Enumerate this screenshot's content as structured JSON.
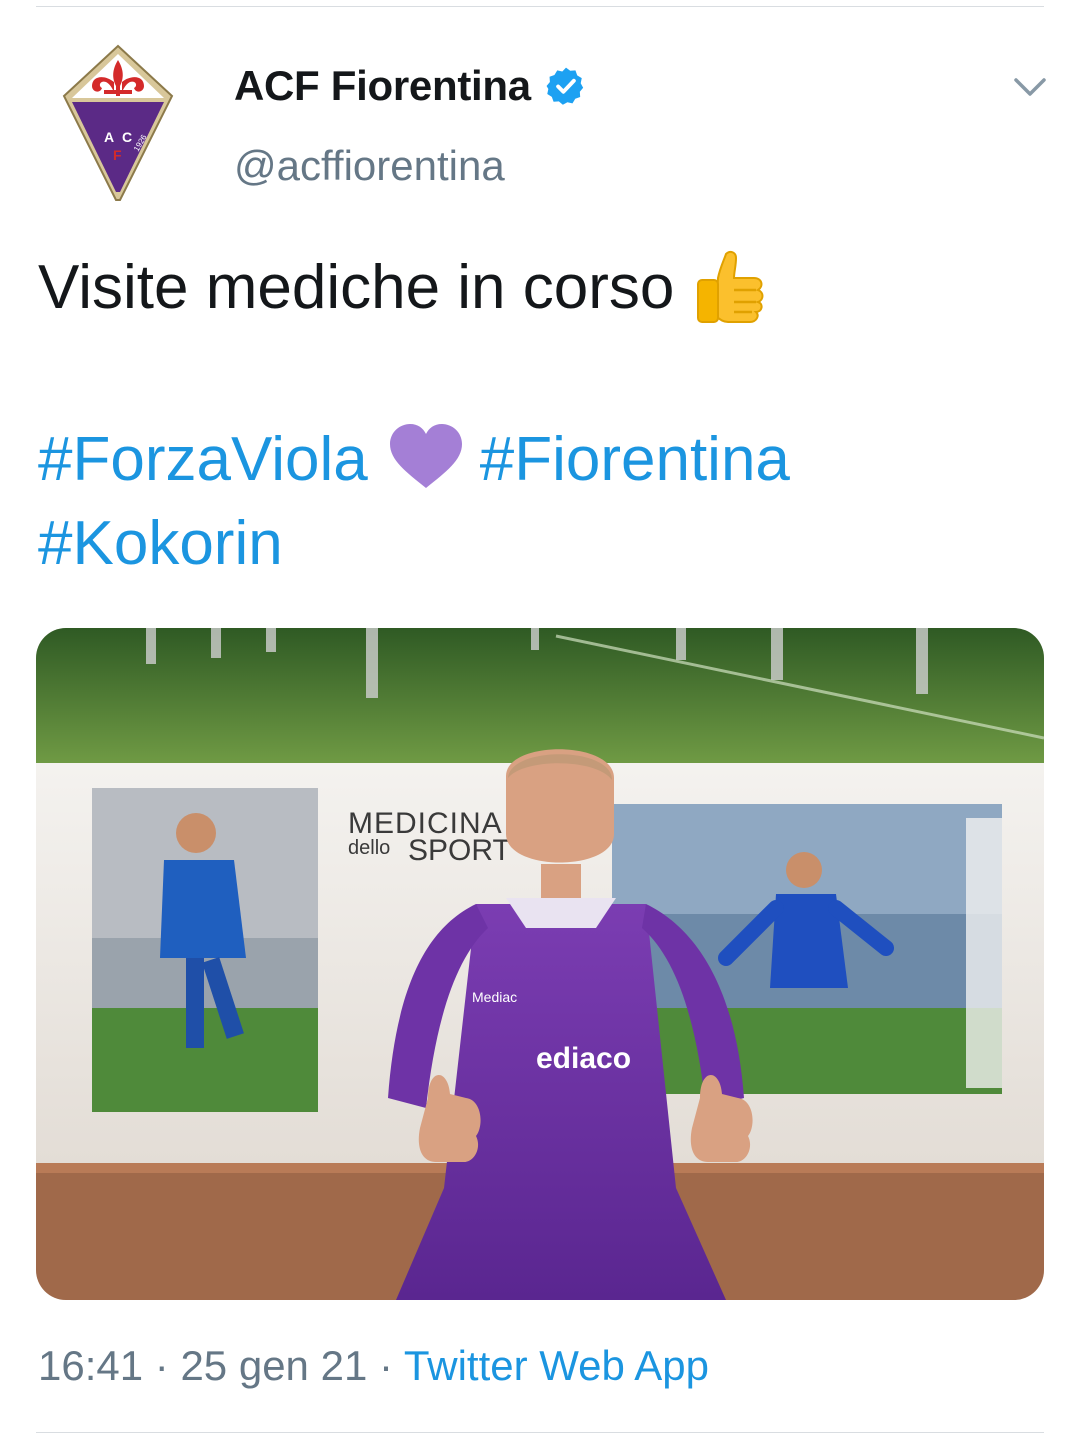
{
  "tweet": {
    "display_name": "ACF Fiorentina",
    "handle": "@acffiorentina",
    "verified": true,
    "text": "Visite mediche in corso",
    "text_emoji": "thumbs-up",
    "hashtags": [
      "#ForzaViola",
      "#Fiorentina",
      "#Kokorin"
    ],
    "hashtag_emoji": "purple-heart",
    "time": "16:41",
    "date": "25 gen 21",
    "separator": "·",
    "source": "Twitter Web App"
  },
  "media": {
    "wall_sign_line1": "MEDICINA",
    "wall_sign_line2_small": "dello",
    "wall_sign_line2": "SPORT",
    "jacket_text": "ediaco",
    "chest_text": "Mediac"
  },
  "colors": {
    "link": "#1b95e0",
    "muted": "#657786",
    "text": "#14171a",
    "verified": "#1da1f2",
    "fiorentina_purple": "#6a2a9c"
  }
}
